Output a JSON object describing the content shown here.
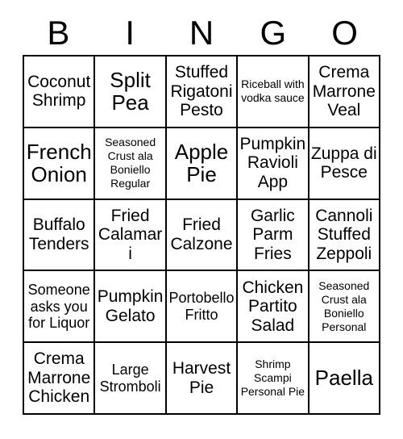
{
  "header": {
    "letters": [
      "B",
      "I",
      "N",
      "G",
      "O"
    ]
  },
  "grid": {
    "columns": 5,
    "rows": 5,
    "border_color": "#000000",
    "background_color": "#ffffff",
    "cells": [
      {
        "text": "Coconut Shrimp",
        "size": "lg"
      },
      {
        "text": "Split Pea",
        "size": "xl"
      },
      {
        "text": "Stuffed Rigatoni Pesto",
        "size": "lg"
      },
      {
        "text": "Riceball with vodka sauce",
        "size": "sm"
      },
      {
        "text": "Crema Marrone Veal",
        "size": "lg"
      },
      {
        "text": "French Onion",
        "size": "xl"
      },
      {
        "text": "Seasoned Crust ala Boniello Regular",
        "size": "sm"
      },
      {
        "text": "Apple Pie",
        "size": "xl"
      },
      {
        "text": "Pumpkin Ravioli App",
        "size": "lg"
      },
      {
        "text": "Zuppa di Pesce",
        "size": "lg"
      },
      {
        "text": "Buffalo Tenders",
        "size": "lg"
      },
      {
        "text": "Fried Calamari",
        "size": "lg"
      },
      {
        "text": "Fried Calzone",
        "size": "lg"
      },
      {
        "text": "Garlic Parm Fries",
        "size": "lg"
      },
      {
        "text": "Cannoli Stuffed Zeppoli",
        "size": "lg"
      },
      {
        "text": "Someone asks you for Liquor",
        "size": "md"
      },
      {
        "text": "Pumpkin Gelato",
        "size": "lg"
      },
      {
        "text": "Portobello Fritto",
        "size": "md"
      },
      {
        "text": "Chicken Partito Salad",
        "size": "lg"
      },
      {
        "text": "Seasoned Crust ala Boniello Personal",
        "size": "sm"
      },
      {
        "text": "Crema Marrone Chicken",
        "size": "lg"
      },
      {
        "text": "Large Stromboli",
        "size": "md"
      },
      {
        "text": "Harvest Pie",
        "size": "lg"
      },
      {
        "text": "Shrimp Scampi Personal Pie",
        "size": "sm"
      },
      {
        "text": "Paella",
        "size": "xl"
      }
    ]
  }
}
